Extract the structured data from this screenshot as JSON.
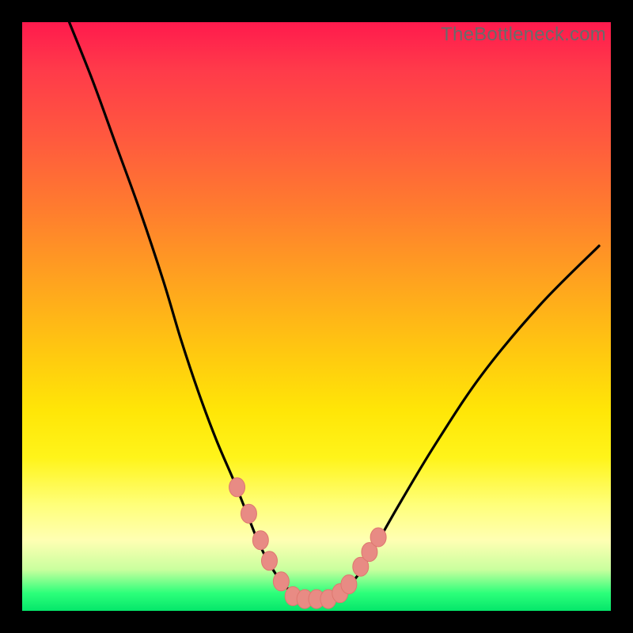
{
  "watermark": {
    "text": "TheBottleneck.com"
  },
  "colors": {
    "curve_stroke": "#000000",
    "marker_fill": "#e88b84",
    "marker_stroke": "#de776f",
    "gradient_top": "#ff1a4d",
    "gradient_bottom": "#05e66a",
    "background": "#000000"
  },
  "chart_data": {
    "type": "line",
    "title": "",
    "xlabel": "",
    "ylabel": "",
    "xlim": [
      0,
      100
    ],
    "ylim": [
      0,
      100
    ],
    "grid": false,
    "legend": null,
    "series": [
      {
        "name": "bottleneck-curve",
        "x": [
          8,
          12,
          16,
          20,
          24,
          27,
          30,
          33,
          36,
          38,
          40,
          42,
          44,
          46,
          48,
          50,
          52,
          54,
          57,
          60,
          64,
          70,
          78,
          88,
          98
        ],
        "y": [
          100,
          90,
          79,
          68,
          56,
          46,
          37,
          29,
          22,
          17,
          12,
          8,
          5,
          3,
          2,
          2,
          2,
          3,
          6,
          11,
          18,
          28,
          40,
          52,
          62
        ]
      }
    ],
    "markers": {
      "name": "highlighted-points",
      "x": [
        36.5,
        38.5,
        40.5,
        42,
        44,
        46,
        48,
        50,
        52,
        54,
        55.5,
        57.5,
        59,
        60.5
      ],
      "y": [
        21,
        16.5,
        12,
        8.5,
        5,
        2.5,
        2,
        2,
        2,
        3,
        4.5,
        7.5,
        10,
        12.5
      ]
    }
  }
}
